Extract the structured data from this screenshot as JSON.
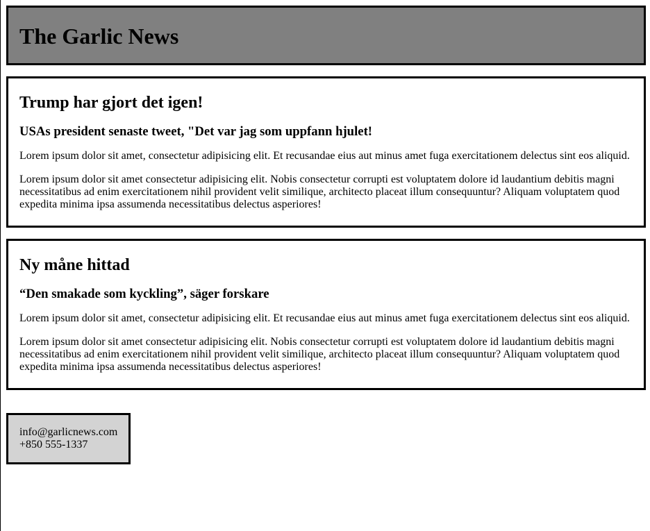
{
  "header": {
    "title": "The Garlic News"
  },
  "articles": [
    {
      "headline": "Trump har gjort det igen!",
      "subheadline": "USAs president senaste tweet, \"Det var jag som uppfann hjulet!",
      "paragraphs": [
        "Lorem ipsum dolor sit amet, consectetur adipisicing elit. Et recusandae eius aut minus amet fuga exercitationem delectus sint eos aliquid.",
        "Lorem ipsum dolor sit amet consectetur adipisicing elit. Nobis consectetur corrupti est voluptatem dolore id laudantium debitis magni necessitatibus ad enim exercitationem nihil provident velit similique, architecto placeat illum consequuntur? Aliquam voluptatem quod expedita minima ipsa assumenda necessitatibus delectus asperiores!"
      ]
    },
    {
      "headline": "Ny måne hittad",
      "subheadline": "“Den smakade som kyckling”, säger forskare",
      "paragraphs": [
        "Lorem ipsum dolor sit amet, consectetur adipisicing elit. Et recusandae eius aut minus amet fuga exercitationem delectus sint eos aliquid.",
        "Lorem ipsum dolor sit amet consectetur adipisicing elit. Nobis consectetur corrupti est voluptatem dolore id laudantium debitis magni necessitatibus ad enim exercitationem nihil provident velit similique, architecto placeat illum consequuntur? Aliquam voluptatem quod expedita minima ipsa assumenda necessitatibus delectus asperiores!"
      ]
    }
  ],
  "contact": {
    "email": "info@garlicnews.com",
    "phone": "+850 555-1337"
  },
  "colors": {
    "header_background": "#808080",
    "contact_background": "#d3d3d3",
    "border": "#000000"
  }
}
